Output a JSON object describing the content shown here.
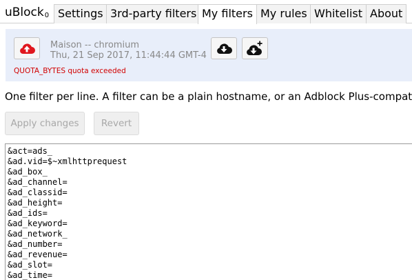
{
  "app": {
    "brand": "uBlock",
    "brand_sub": "0"
  },
  "tabs": [
    {
      "label": "Settings"
    },
    {
      "label": "3rd-party filters"
    },
    {
      "label": "My filters",
      "active": true
    },
    {
      "label": "My rules"
    },
    {
      "label": "Whitelist"
    },
    {
      "label": "About"
    }
  ],
  "cloud": {
    "device": "Maison -- chromium",
    "timestamp": "Thu, 21 Sep 2017, 11:44:44 GMT-4",
    "error": "QUOTA_BYTES quota exceeded",
    "push_icon": "cloud-upload-icon",
    "pull_icon": "cloud-download-icon",
    "merge_icon": "cloud-download-merge-icon"
  },
  "description": "One filter per line. A filter can be a plain hostname, or an Adblock Plus-compatible filter. Lines prefixed with ! will be ignored.",
  "buttons": {
    "apply": "Apply changes",
    "revert": "Revert"
  },
  "colors": {
    "accent_red": "#e0171d",
    "panel_bg": "#e8eefa",
    "error": "#d10000"
  },
  "filters": [
    "&act=ads_",
    "&ad.vid=$~xmlhttprequest",
    "&ad_box_",
    "&ad_channel=",
    "&ad_classid=",
    "&ad_height=",
    "&ad_ids=",
    "&ad_keyword=",
    "&ad_network_",
    "&ad_number=",
    "&ad_revenue=",
    "&ad_slot=",
    "&ad_time="
  ]
}
